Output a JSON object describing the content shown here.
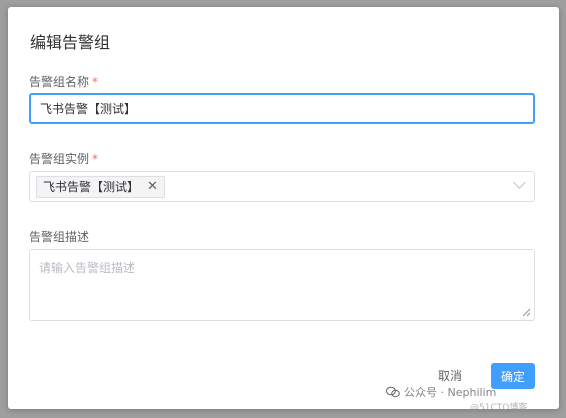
{
  "dialog": {
    "title": "编辑告警组"
  },
  "form": {
    "name_label": "告警组名称",
    "name_value": "飞书告警【测试】",
    "instance_label": "告警组实例",
    "instance_tags": [
      "飞书告警【测试】"
    ],
    "desc_label": "告警组描述",
    "desc_placeholder": "请输入告警组描述",
    "required_mark": "*"
  },
  "footer": {
    "cancel_label": "取消",
    "confirm_label": "确定"
  },
  "watermark": {
    "text": "公众号 · Nephilim",
    "sub": "@51CTO博客"
  },
  "colors": {
    "primary": "#409eff",
    "required": "#f56c6c"
  }
}
